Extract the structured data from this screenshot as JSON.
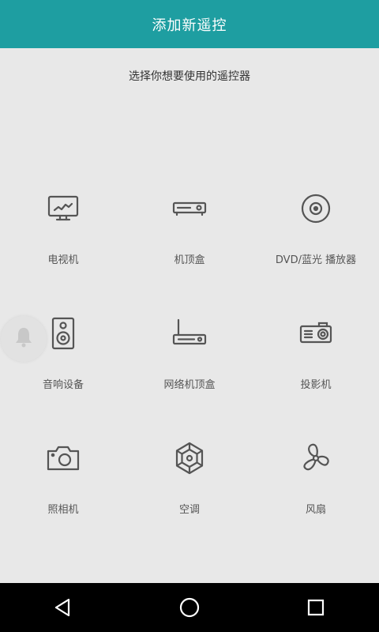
{
  "header": {
    "title": "添加新遥控"
  },
  "instruction": "选择你想要使用的遥控器",
  "devices": [
    {
      "label": "电视机",
      "icon": "tv-icon"
    },
    {
      "label": "机顶盒",
      "icon": "set-top-box-icon"
    },
    {
      "label": "DVD/蓝光 播放器",
      "icon": "disc-player-icon"
    },
    {
      "label": "音响设备",
      "icon": "speaker-icon"
    },
    {
      "label": "网络机顶盒",
      "icon": "network-box-icon"
    },
    {
      "label": "投影机",
      "icon": "projector-icon"
    },
    {
      "label": "照相机",
      "icon": "camera-icon"
    },
    {
      "label": "空调",
      "icon": "snowflake-icon"
    },
    {
      "label": "风扇",
      "icon": "fan-icon"
    }
  ],
  "floating_button": {
    "icon": "bell-icon"
  },
  "navigation": {
    "back": "back-icon",
    "home": "home-icon",
    "recents": "recents-icon"
  },
  "colors": {
    "header": "#1e9ea1",
    "background": "#e8e8e8",
    "icon": "#555555",
    "navbar": "#000000"
  }
}
